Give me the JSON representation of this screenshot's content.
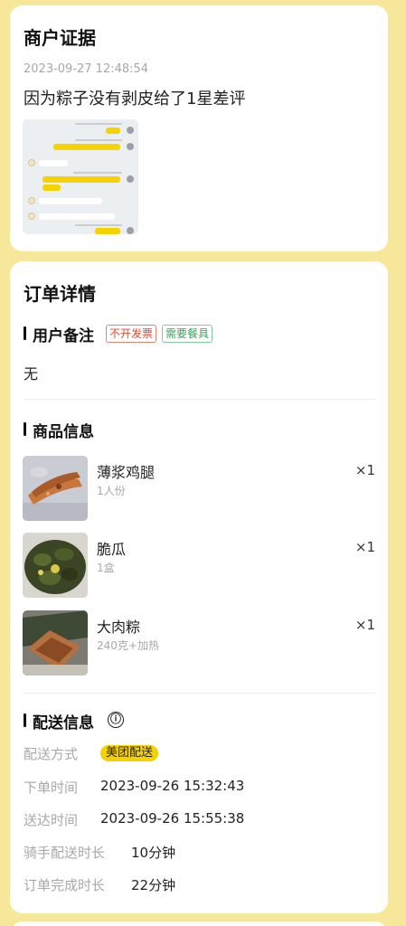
{
  "evidence": {
    "title": "商户证据",
    "timestamp": "2023-09-27 12:48:54",
    "text": "因为粽子没有剥皮给了1星差评",
    "image_icon": "chat-screenshot-icon"
  },
  "order": {
    "title": "订单详情",
    "remark": {
      "title": "用户备注",
      "tags": [
        "不开发票",
        "需要餐具"
      ],
      "value": "无"
    },
    "products": {
      "title": "商品信息",
      "items": [
        {
          "name": "薄浆鸡腿",
          "spec": "1人份",
          "qty": "×1",
          "image": "chicken-leg-photo"
        },
        {
          "name": "脆瓜",
          "spec": "1盒",
          "qty": "×1",
          "image": "pickled-cucumber-photo"
        },
        {
          "name": "大肉粽",
          "spec": "240克+加热",
          "qty": "×1",
          "image": "zongzi-photo"
        }
      ]
    },
    "delivery": {
      "title": "配送信息",
      "info_icon": "ⓘ",
      "method_label": "配送方式",
      "method_value": "美团配送",
      "rows": [
        {
          "label": "下单时间",
          "value": "2023-09-26 15:32:43"
        },
        {
          "label": "送达时间",
          "value": "2023-09-26 15:55:38"
        },
        {
          "label": "骑手配送时长",
          "value": "10分钟"
        },
        {
          "label": "订单完成时长",
          "value": "22分钟"
        }
      ]
    }
  },
  "colors": {
    "background": "#f7e79a",
    "accent_yellow": "#f5d200",
    "tag_red": "#e14a35",
    "tag_green": "#3aa35b"
  }
}
